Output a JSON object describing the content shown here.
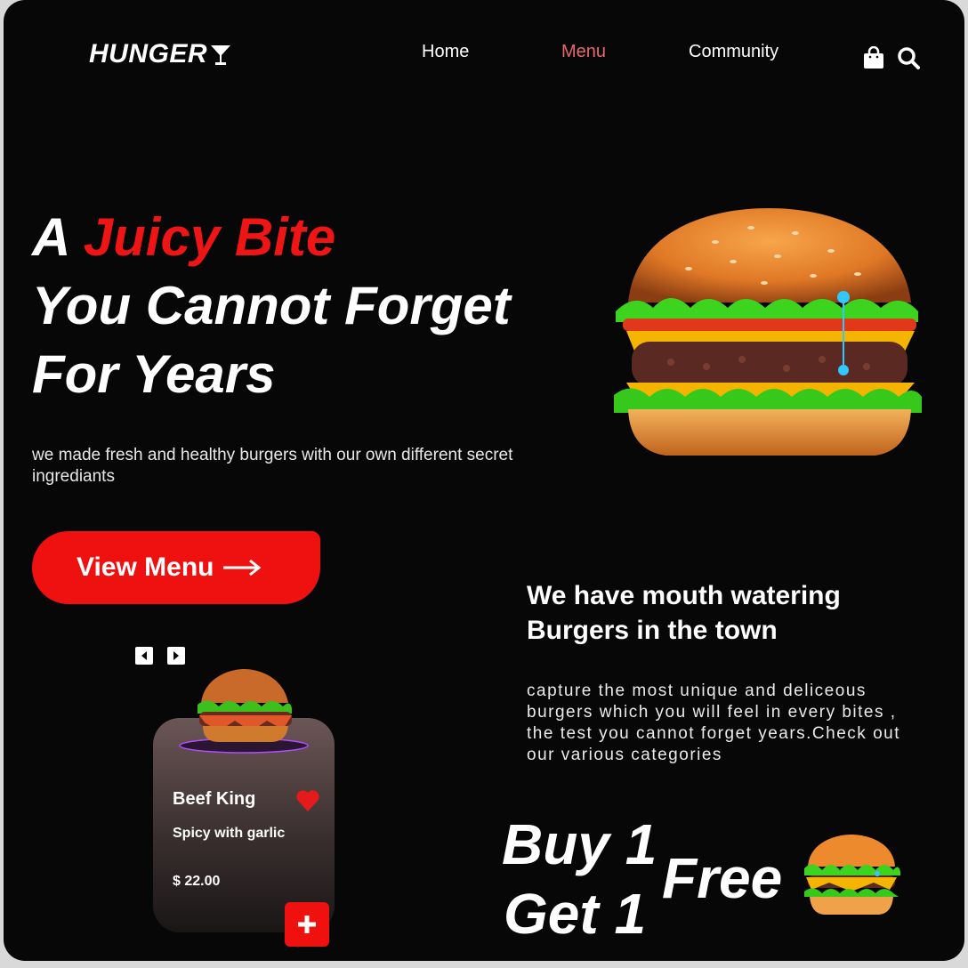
{
  "brand": {
    "logo_text": "HUNGER"
  },
  "nav": {
    "items": [
      {
        "label": "Home",
        "active": false
      },
      {
        "label": "Menu",
        "active": true
      },
      {
        "label": "Community",
        "active": false
      }
    ],
    "icons": [
      "shopping-bag-icon",
      "search-icon"
    ]
  },
  "hero": {
    "title_prefix": "A",
    "title_highlight": "Juicy Bite",
    "title_line2": "You Cannot Forget",
    "title_line3": "For Years",
    "subtitle": "we made fresh and healthy burgers with our own different secret ingrediants",
    "cta_label": "View Menu"
  },
  "section": {
    "title_line1": "We have mouth watering",
    "title_line2": "Burgers in the town",
    "text": "capture the most unique and deliceous burgers which you will feel in every bites , the test you cannot forget years.Check out our various categories"
  },
  "product_card": {
    "name": "Beef King",
    "description": "Spicy with garlic",
    "price": "$ 22.00",
    "favorited": true
  },
  "promo": {
    "line1": "Buy 1",
    "line2": "Get 1",
    "free": "Free"
  },
  "colors": {
    "accent": "#ef1010",
    "active_nav": "#e8676e",
    "background": "#070707"
  }
}
